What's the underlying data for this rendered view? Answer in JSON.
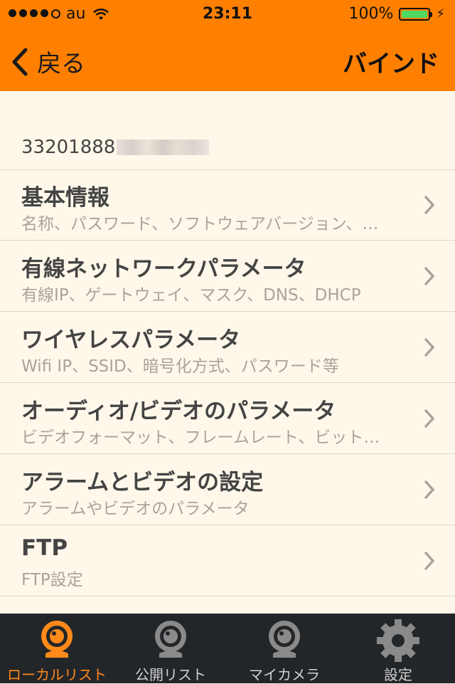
{
  "status_bar": {
    "carrier": "au",
    "time": "23:11",
    "battery": "100%"
  },
  "nav": {
    "back_label": "戻る",
    "action_label": "バインド"
  },
  "device": {
    "id": "33201888"
  },
  "menu": {
    "items": [
      {
        "title": "基本情報",
        "subtitle": "名称、パスワード、ソフトウェアバージョン、…"
      },
      {
        "title": "有線ネットワークパラメータ",
        "subtitle": "有線IP、ゲートウェイ、マスク、DNS、DHCP"
      },
      {
        "title": "ワイヤレスパラメータ",
        "subtitle": "Wifi IP、SSID、暗号化方式、パスワード等"
      },
      {
        "title": "オーディオ/ビデオのパラメータ",
        "subtitle": "ビデオフォーマット、フレームレート、ビット…"
      },
      {
        "title": "アラームとビデオの設定",
        "subtitle": "アラームやビデオのパラメータ"
      },
      {
        "title": "FTP",
        "subtitle": "FTP設定"
      }
    ]
  },
  "tabbar": {
    "tabs": [
      {
        "label": "ローカルリスト",
        "icon": "webcam-icon",
        "active": true
      },
      {
        "label": "公開リスト",
        "icon": "webcam-icon",
        "active": false
      },
      {
        "label": "マイカメラ",
        "icon": "webcam-icon",
        "active": false
      },
      {
        "label": "設定",
        "icon": "gear-icon",
        "active": false
      }
    ]
  },
  "colors": {
    "accent": "#ff8000",
    "background": "#fff8ea",
    "tabbar": "#232629",
    "active_tab": "#ff8a1a",
    "inactive_tab_icon": "#8a8a8a"
  }
}
